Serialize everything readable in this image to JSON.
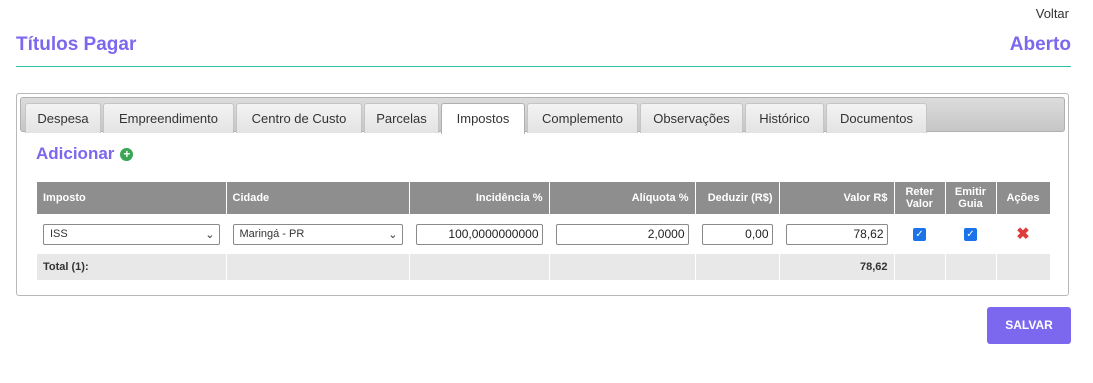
{
  "header": {
    "back_label": "Voltar",
    "title": "Títulos Pagar",
    "status": "Aberto"
  },
  "tabs": [
    {
      "label": "Despesa"
    },
    {
      "label": "Empreendimento"
    },
    {
      "label": "Centro de Custo"
    },
    {
      "label": "Parcelas"
    },
    {
      "label": "Impostos",
      "active": true
    },
    {
      "label": "Complemento"
    },
    {
      "label": "Observações"
    },
    {
      "label": "Histórico"
    },
    {
      "label": "Documentos"
    }
  ],
  "section": {
    "add_label": "Adicionar",
    "add_icon": "plus-circle-icon"
  },
  "table": {
    "headers": {
      "imposto": "Imposto",
      "cidade": "Cidade",
      "incidencia": "Incidência %",
      "aliquota": "Alíquota %",
      "deduzir": "Deduzir (R$)",
      "valor": "Valor R$",
      "reter_1": "Reter",
      "reter_2": "Valor",
      "emitir_1": "Emitir",
      "emitir_2": "Guia",
      "acoes": "Ações"
    },
    "rows": [
      {
        "imposto": "ISS",
        "cidade": "Maringá - PR",
        "incidencia": "100,0000000000",
        "aliquota": "2,0000",
        "deduzir": "0,00",
        "valor": "78,62",
        "reter_valor": true,
        "emitir_guia": true
      }
    ],
    "total": {
      "label": "Total (1):",
      "valor": "78,62"
    }
  },
  "actions": {
    "save_label": "SALVAR"
  },
  "colors": {
    "accent": "#7b68ee",
    "divider": "#2ec4a5",
    "header_bg": "#8e8e8e",
    "delete": "#e03c3c"
  }
}
